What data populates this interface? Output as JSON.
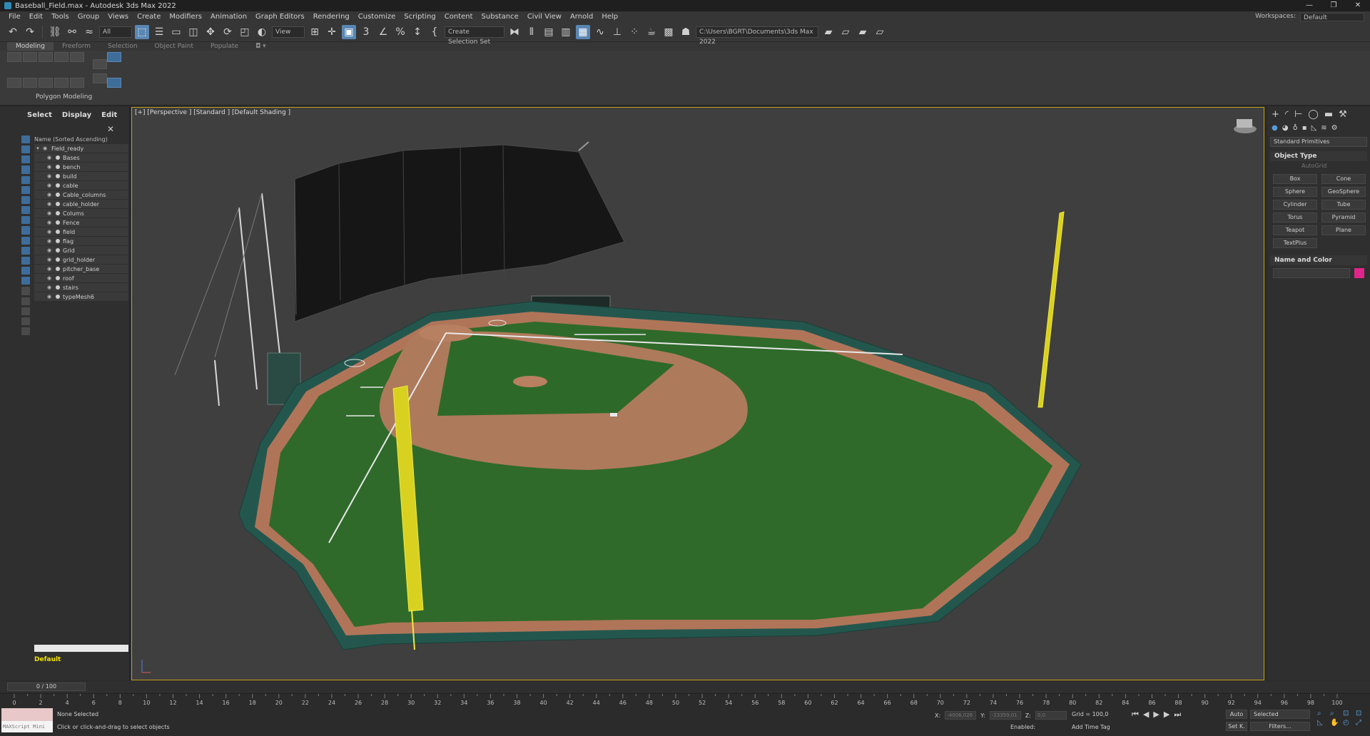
{
  "window": {
    "title": "Baseball_Field.max - Autodesk 3ds Max 2022",
    "minimize": "—",
    "maximize": "❐",
    "close": "✕"
  },
  "menu": {
    "items": [
      "File",
      "Edit",
      "Tools",
      "Group",
      "Views",
      "Create",
      "Modifiers",
      "Animation",
      "Graph Editors",
      "Rendering",
      "Customize",
      "Scripting",
      "Content",
      "Substance",
      "Civil View",
      "Arnold",
      "Help"
    ],
    "workspaces_label": "Workspaces:",
    "workspaces_value": "Default"
  },
  "toolbar": {
    "filter_value": "All",
    "refcoord_value": "View",
    "selection_set_value": "Create Selection Set",
    "project_path": "C:\\Users\\BGRT\\Documents\\3ds Max 2022"
  },
  "ribbon": {
    "tabs": [
      "Modeling",
      "Freeform",
      "Selection",
      "Object Paint",
      "Populate"
    ],
    "active_tab": "Modeling",
    "panel_label": "Polygon Modeling"
  },
  "explorer": {
    "tabs": [
      "Select",
      "Display",
      "Edit"
    ],
    "column_header": "Name (Sorted Ascending)",
    "root": "Field_ready",
    "children": [
      "Bases",
      "bench",
      "build",
      "cable",
      "Cable_columns",
      "cable_holder",
      "Colums",
      "Fence",
      "field",
      "flag",
      "Grid",
      "grid_holder",
      "pitcher_base",
      "roof",
      "stairs",
      "typeMesh6"
    ],
    "layer": "Default"
  },
  "viewport": {
    "label": "[+] [Perspective ] [Standard ] [Default Shading ]"
  },
  "command_panel": {
    "category": "Standard Primitives",
    "object_type_title": "Object Type",
    "autogrid": "AutoGrid",
    "buttons": [
      "Box",
      "Cone",
      "Sphere",
      "GeoSphere",
      "Cylinder",
      "Tube",
      "Torus",
      "Pyramid",
      "Teapot",
      "Plane",
      "TextPlus"
    ],
    "name_color_title": "Name and Color",
    "color": "#e0258a"
  },
  "timeline": {
    "frame_display": "0 / 100",
    "ticks": [
      0,
      2,
      4,
      6,
      8,
      10,
      12,
      14,
      16,
      18,
      20,
      22,
      24,
      26,
      28,
      30,
      32,
      34,
      36,
      38,
      40,
      42,
      44,
      46,
      48,
      50,
      52,
      54,
      56,
      58,
      60,
      62,
      64,
      66,
      68,
      70,
      72,
      74,
      76,
      78,
      80,
      82,
      84,
      86,
      88,
      90,
      92,
      94,
      96,
      98,
      100
    ]
  },
  "status": {
    "maxscript": "MAXScript Mini",
    "selection": "None Selected",
    "prompt": "Click or click-and-drag to select objects",
    "x_label": "X:",
    "x_value": "-4006,026",
    "y_label": "Y:",
    "y_value": "-23359,01",
    "z_label": "Z:",
    "z_value": "0,0",
    "grid": "Grid = 100,0",
    "enabled": "Enabled:",
    "add_time_tag": "Add Time Tag",
    "auto_key": "Auto",
    "set_key": "Set K.",
    "selected": "Selected",
    "filters": "Filters..."
  }
}
